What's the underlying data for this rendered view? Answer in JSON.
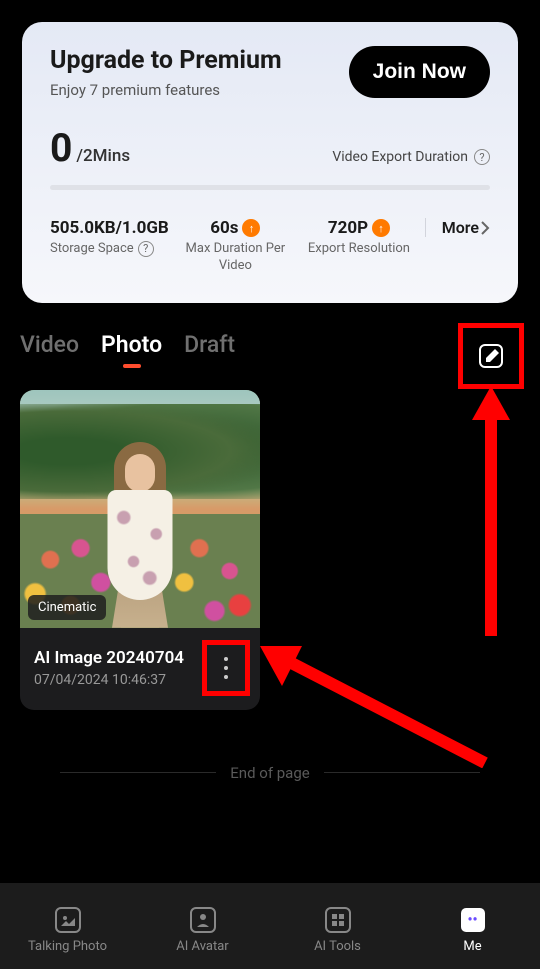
{
  "premium": {
    "title": "Upgrade to Premium",
    "subtitle": "Enjoy 7 premium features",
    "join_label": "Join Now",
    "usage_value": "0",
    "usage_unit": "/2Mins",
    "export_label": "Video Export Duration"
  },
  "stats": {
    "storage_value": "505.0KB/1.0GB",
    "storage_label": "Storage Space",
    "duration_value": "60s",
    "duration_label": "Max Duration Per Video",
    "resolution_value": "720P",
    "resolution_label": "Export Resolution",
    "more_label": "More"
  },
  "tabs": {
    "video": "Video",
    "photo": "Photo",
    "draft": "Draft"
  },
  "photo_card": {
    "badge": "Cinematic",
    "title": "AI Image 20240704",
    "date": "07/04/2024 10:46:37"
  },
  "end_text": "End of page",
  "nav": {
    "talking_photo": "Talking Photo",
    "ai_avatar": "AI Avatar",
    "ai_tools": "AI Tools",
    "me": "Me"
  }
}
